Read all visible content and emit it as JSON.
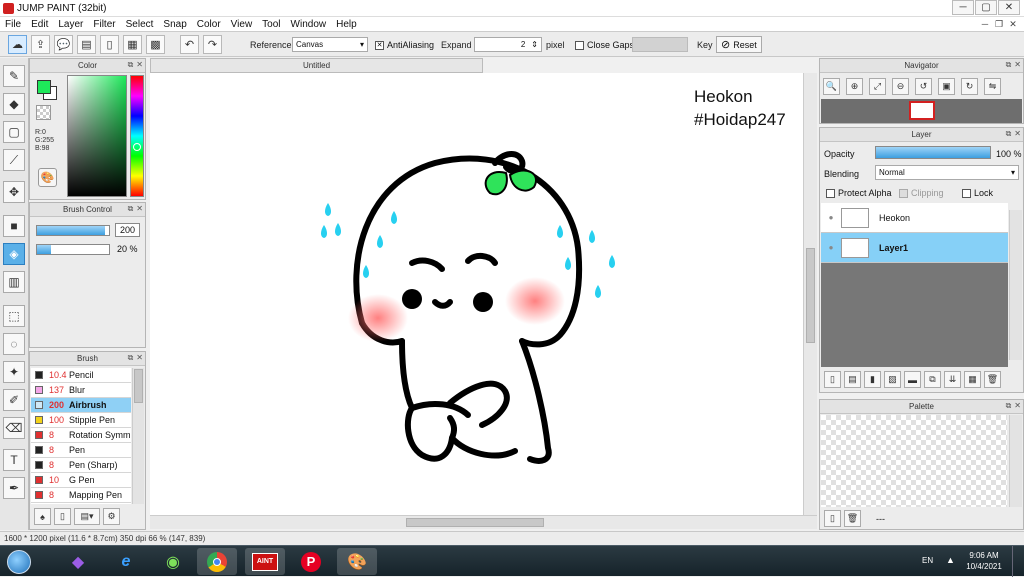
{
  "window": {
    "title": "JUMP PAINT (32bit)"
  },
  "menu": [
    "File",
    "Edit",
    "Layer",
    "Filter",
    "Select",
    "Snap",
    "Color",
    "View",
    "Tool",
    "Window",
    "Help"
  ],
  "toolbar": {
    "reference_label": "Reference",
    "reference_value": "Canvas",
    "antialiasing_label": "AntiAliasing",
    "expand_label": "Expand",
    "expand_value": "2",
    "pixel_label": "pixel",
    "close_gaps_label": "Close Gaps",
    "key_label": "Key",
    "reset_label": "Reset"
  },
  "color_panel": {
    "title": "Color",
    "r": "R:0",
    "g": "G:255",
    "b": "B:98",
    "fg": "#1ee85a",
    "bg": "#ffffff"
  },
  "brush_control": {
    "title": "Brush Control",
    "size_value": "200",
    "density_value": "20 %",
    "size_fraction": 0.95,
    "density_fraction": 0.2
  },
  "brush_panel": {
    "title": "Brush",
    "items": [
      {
        "size": "10.4",
        "name": "Pencil",
        "color": "#222222"
      },
      {
        "size": "137",
        "name": "Blur",
        "color": "#f4a6e8"
      },
      {
        "size": "200",
        "name": "Airbrush",
        "color": "#cfe8f5"
      },
      {
        "size": "100",
        "name": "Stipple Pen",
        "color": "#f3d21a"
      },
      {
        "size": "8",
        "name": "Rotation Symm",
        "color": "#e03030"
      },
      {
        "size": "8",
        "name": "Pen",
        "color": "#222222"
      },
      {
        "size": "8",
        "name": "Pen (Sharp)",
        "color": "#222222"
      },
      {
        "size": "10",
        "name": "G Pen",
        "color": "#e03030"
      },
      {
        "size": "8",
        "name": "Mapping Pen",
        "color": "#e03030"
      }
    ]
  },
  "document": {
    "tab": "Untitled",
    "text_line1": "Heokon",
    "text_line2": "#Hoidap247"
  },
  "navigator": {
    "title": "Navigator"
  },
  "layer_panel": {
    "title": "Layer",
    "opacity_label": "Opacity",
    "opacity_value": "100 %",
    "blending_label": "Blending",
    "blending_value": "Normal",
    "protect_alpha": "Protect Alpha",
    "clipping": "Clipping",
    "lock": "Lock",
    "layers": [
      {
        "name": "Heokon"
      },
      {
        "name": "Layer1"
      }
    ]
  },
  "palette": {
    "title": "Palette",
    "dots": "---"
  },
  "status": {
    "text": "1600 * 1200 pixel   (11.6 * 8.7cm)   350 dpi   66 %   (147, 839)"
  },
  "taskbar": {
    "lang": "EN",
    "time": "9:06 AM",
    "date": "10/4/2021",
    "paint_label": "AINT"
  }
}
